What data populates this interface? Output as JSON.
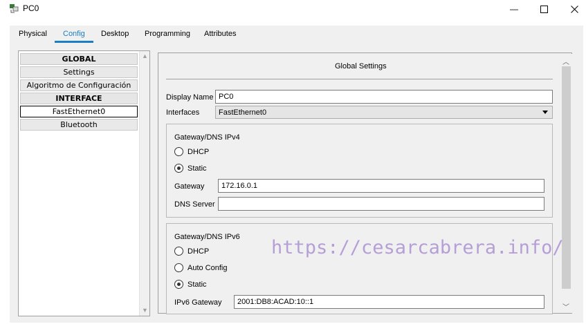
{
  "window": {
    "title": "PC0",
    "minimize_glyph": "—",
    "maximize_glyph": "☐",
    "close_glyph": "✕"
  },
  "tabs": [
    {
      "label": "Physical"
    },
    {
      "label": "Config"
    },
    {
      "label": "Desktop"
    },
    {
      "label": "Programming"
    },
    {
      "label": "Attributes"
    }
  ],
  "sidebar": {
    "items": [
      {
        "label": "GLOBAL"
      },
      {
        "label": "Settings"
      },
      {
        "label": "Algoritmo de Configuración"
      },
      {
        "label": "INTERFACE"
      },
      {
        "label": "FastEthernet0"
      },
      {
        "label": "Bluetooth"
      }
    ]
  },
  "global_settings": {
    "title": "Global Settings",
    "display_name_label": "Display Name",
    "display_name_value": "PC0",
    "interfaces_label": "Interfaces",
    "interfaces_value": "FastEthernet0"
  },
  "ipv4": {
    "title": "Gateway/DNS IPv4",
    "dhcp_label": "DHCP",
    "static_label": "Static",
    "gateway_label": "Gateway",
    "gateway_value": "172.16.0.1",
    "dns_label": "DNS Server",
    "dns_value": ""
  },
  "ipv6": {
    "title": "Gateway/DNS IPv6",
    "dhcp_label": "DHCP",
    "auto_label": "Auto Config",
    "static_label": "Static",
    "gateway_label": "IPv6 Gateway",
    "gateway_value": "2001:DB8:ACAD:10::1"
  },
  "watermark": "https://cesarcabrera.info/",
  "colors": {
    "accent": "#1a7ec3",
    "watermark": "#b59fd6",
    "panel_bg": "#f0f0f0"
  }
}
